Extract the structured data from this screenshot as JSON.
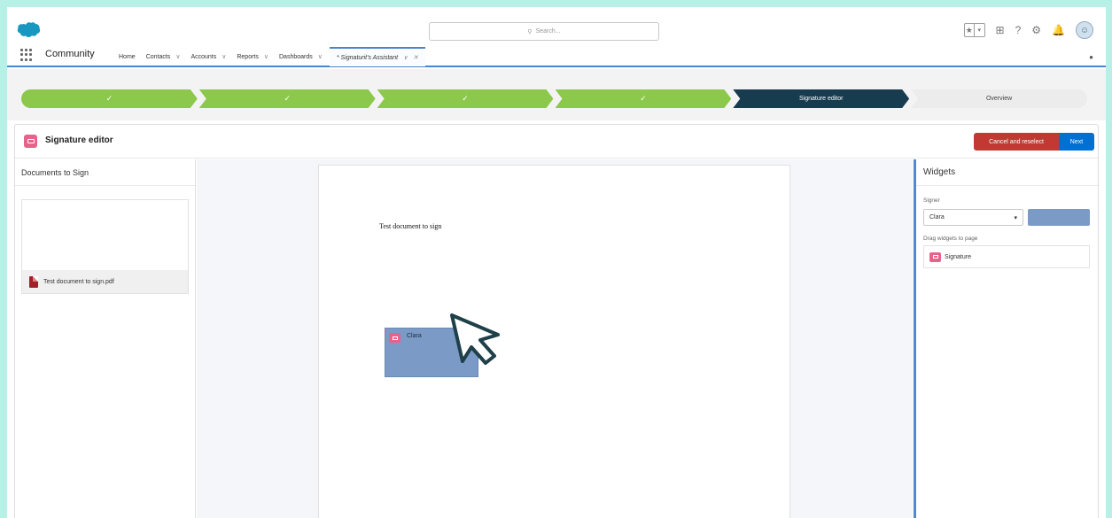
{
  "header": {
    "search_placeholder": "Search...",
    "app_name": "Community",
    "nav_items": [
      "Home",
      "Contacts",
      "Accounts",
      "Reports",
      "Dashboards"
    ],
    "active_tab": "* Signaturit's Assistant"
  },
  "path": {
    "steps": [
      {
        "label": "✓",
        "state": "done"
      },
      {
        "label": "✓",
        "state": "done"
      },
      {
        "label": "✓",
        "state": "done"
      },
      {
        "label": "✓",
        "state": "done"
      },
      {
        "label": "Signature editor",
        "state": "current"
      },
      {
        "label": "Overview",
        "state": "todo"
      }
    ]
  },
  "editor": {
    "title": "Signature editor",
    "cancel_label": "Cancel and reselect",
    "next_label": "Next"
  },
  "documents": {
    "title": "Documents to Sign",
    "file_name": "Test document to sign.pdf"
  },
  "page": {
    "text": "Test document to sign",
    "widget_signer": "Clara"
  },
  "widgets": {
    "title": "Widgets",
    "signer_label": "Signer",
    "signer_value": "Clara",
    "drag_label": "Drag widgets to page",
    "items": [
      "Signature"
    ]
  },
  "colors": {
    "accent": "#4a85c8",
    "step_done": "#8cc84b",
    "step_current": "#173b4f",
    "cancel": "#c23934",
    "next": "#0070d2",
    "signer_color": "#7b9ac6",
    "border": "#b7f0e7"
  }
}
